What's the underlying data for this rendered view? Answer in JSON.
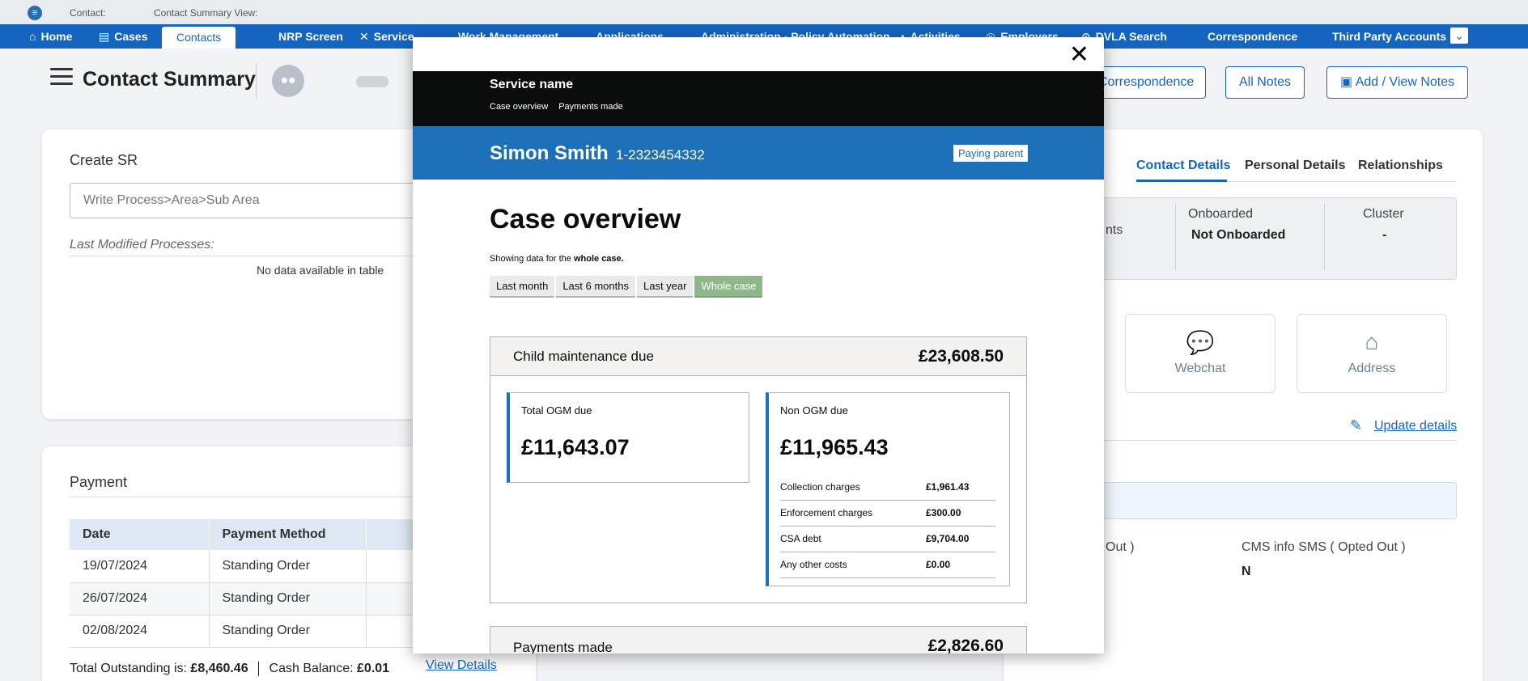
{
  "topstrip": {
    "crumb1": "Contact:",
    "crumb2": "Contact Summary View:"
  },
  "nav": {
    "home": "Home",
    "cases": "Cases",
    "contacts": "Contacts",
    "nrp": "NRP Screen",
    "service": "Service",
    "work": "Work Management",
    "applications": "Applications",
    "admin": "Administration - Policy Automation",
    "activities": "Activities",
    "employers": "Employers",
    "dvla": "DVLA Search",
    "correspondence": "Correspondence",
    "third_party": "Third Party Accounts"
  },
  "page": {
    "title": "Contact Summary"
  },
  "header_buttons": {
    "correspondence": "Correspondence",
    "all_notes": "All Notes",
    "add_notes": "Add / View Notes"
  },
  "create_sr": {
    "title": "Create SR",
    "placeholder": "Write Process>Area>Sub Area",
    "last_modified": "Last Modified Processes:",
    "empty": "No data available in table"
  },
  "payment": {
    "title": "Payment",
    "columns": [
      "Date",
      "Payment Method"
    ],
    "rows": [
      {
        "date": "19/07/2024",
        "method": "Standing Order"
      },
      {
        "date": "26/07/2024",
        "method": "Standing Order"
      },
      {
        "date": "02/08/2024",
        "method": "Standing Order"
      }
    ],
    "outstanding_label": "Total Outstanding is:",
    "outstanding_value": "£8,460.46",
    "cash_label": "Cash Balance:",
    "cash_value": "£0.01",
    "view_details": "View Details"
  },
  "right_panel": {
    "tabs": [
      "Contact Details",
      "Personal Details",
      "Relationships"
    ],
    "partial_label": "nts",
    "onboarded_label": "Onboarded",
    "onboarded_value": "Not Onboarded",
    "cluster_label": "Cluster",
    "cluster_value": "-",
    "tiles": [
      {
        "label": "Webchat",
        "icon": "webchat-icon"
      },
      {
        "label": "Address",
        "icon": "address-icon"
      }
    ],
    "update_details": "Update details",
    "optout_partial": "Out )",
    "cms_sms_label": "CMS info SMS ( Opted Out )",
    "cms_sms_value": "N"
  },
  "modal": {
    "service_name": "Service name",
    "links": [
      "Case overview",
      "Payments made"
    ],
    "person_name": "Simon Smith",
    "person_id": "1-2323454332",
    "person_tag": "Paying parent",
    "heading": "Case overview",
    "showing_prefix": "Showing data for the",
    "showing_bold": "whole case.",
    "filters": [
      "Last month",
      "Last 6 months",
      "Last year",
      "Whole case"
    ],
    "selected_filter": "Whole case",
    "cmd_label": "Child maintenance due",
    "cmd_value": "£23,608.50",
    "ogm_label": "Total OGM due",
    "ogm_value": "£11,643.07",
    "non_ogm_label": "Non OGM due",
    "non_ogm_value": "£11,965.43",
    "breakdown": [
      {
        "label": "Collection charges",
        "value": "£1,961.43"
      },
      {
        "label": "Enforcement charges",
        "value": "£300.00"
      },
      {
        "label": "CSA debt",
        "value": "£9,704.00"
      },
      {
        "label": "Any other costs",
        "value": "£0.00"
      }
    ],
    "payments_label": "Payments made",
    "payments_value": "£2,826.60"
  }
}
